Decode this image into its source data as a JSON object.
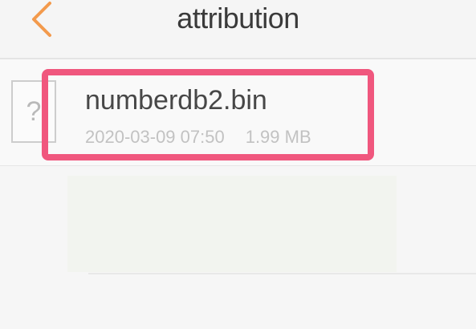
{
  "nav": {
    "title": "attribution",
    "back_icon": "chevron-left-icon",
    "accent_color": "#f39a4c"
  },
  "files": [
    {
      "icon": "unknown-file-icon",
      "icon_glyph": "?",
      "name": "numberdb2.bin",
      "date": "2020-03-09 07:50",
      "size": "1.99 MB"
    }
  ],
  "highlight_color": "#f0577e"
}
